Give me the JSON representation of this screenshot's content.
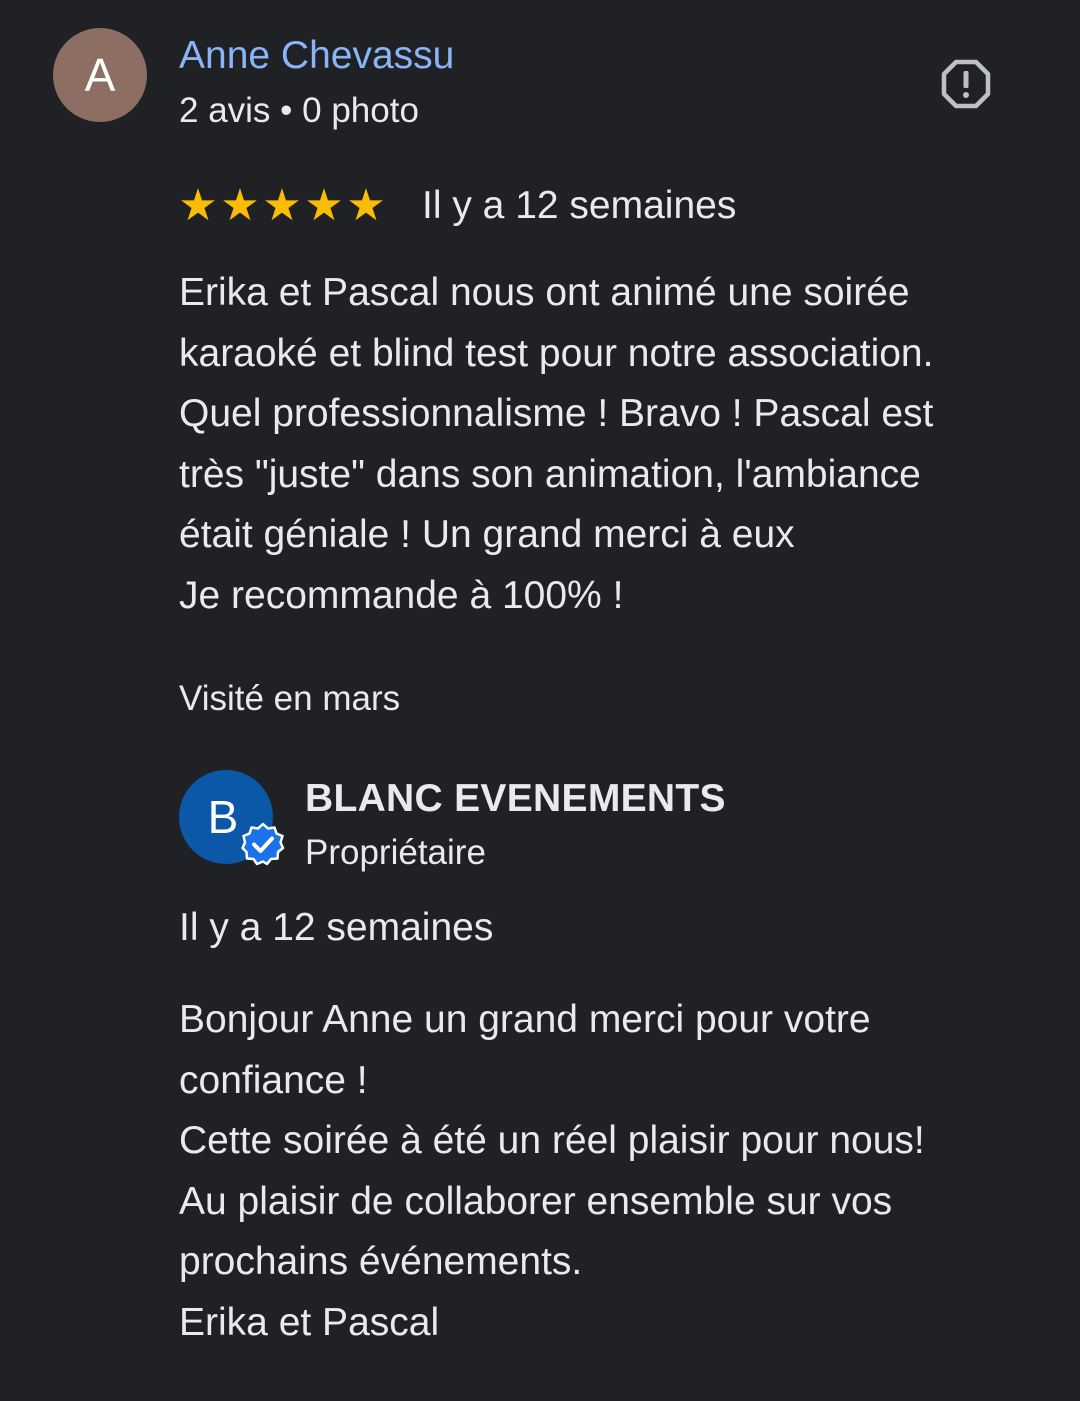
{
  "review": {
    "reviewer": {
      "initial": "A",
      "name": "Anne Chevassu",
      "meta": "2 avis • 0 photo"
    },
    "report_icon": "report-flag-icon",
    "rating": 5,
    "stars": [
      "★",
      "★",
      "★",
      "★",
      "★"
    ],
    "date": "Il y a 12 semaines",
    "lines": [
      "Erika et Pascal nous ont animé une soirée",
      "karaoké et blind test pour notre association.",
      "Quel professionnalisme ! Bravo ! Pascal est",
      "très \"juste\" dans son animation, l'ambiance",
      "était géniale ! Un grand merci à eux",
      "Je recommande à 100% !"
    ],
    "visited": "Visité en mars"
  },
  "reply": {
    "owner": {
      "initial": "B",
      "name": "BLANC EVENEMENTS",
      "role": "Propriétaire"
    },
    "date": "Il y a 12 semaines",
    "lines": [
      "Bonjour Anne un grand merci pour votre",
      "confiance !",
      "Cette soirée à été un réel plaisir pour nous!",
      "Au plaisir de collaborer ensemble sur vos",
      "prochains événements.",
      "Erika et Pascal"
    ]
  },
  "colors": {
    "background": "#202124",
    "link": "#8ab4f8",
    "star": "#fbbc04",
    "reviewer_avatar": "#8d6e63",
    "owner_avatar": "#0b57a8",
    "verified": "#1a73e8"
  }
}
